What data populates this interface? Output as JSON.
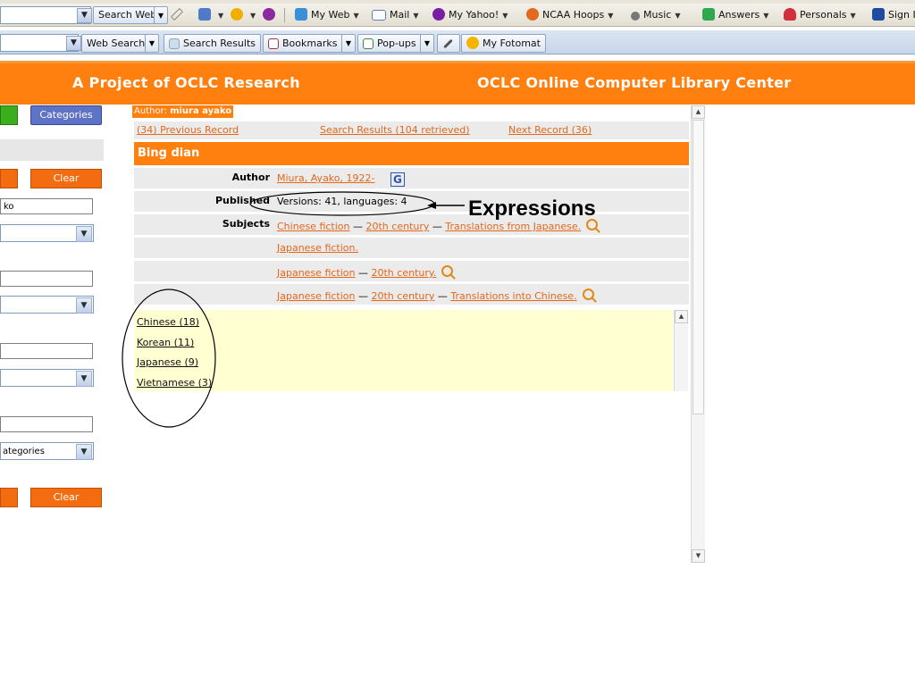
{
  "toolbar1": {
    "search_web": "Search Web",
    "my_web": "My Web",
    "mail": "Mail",
    "my_yahoo": "My Yahoo!",
    "ncaa_hoops": "NCAA Hoops",
    "music": "Music",
    "answers": "Answers",
    "personals": "Personals",
    "sign_in": "Sign In"
  },
  "toolbar2": {
    "web_search": "Web Search",
    "search_results": "Search Results",
    "bookmarks": "Bookmarks",
    "popups": "Pop-ups",
    "my_fotomat": "My Fotomat"
  },
  "banner": {
    "left": "A Project of OCLC Research",
    "right": "OCLC Online Computer Library Center"
  },
  "left_panel": {
    "categories_button": "Categories",
    "clear_button_1": "Clear",
    "clear_button_2": "Clear",
    "author_field_value": "ko",
    "categories_select_value": "ategories"
  },
  "record": {
    "author_prefix": "Author:",
    "author_value": "miura ayako",
    "prev_link": "(34) Previous Record",
    "search_results_link": "Search Results (104 retrieved)",
    "next_link": "Next Record (36)",
    "title": "Bing dian",
    "author_label": "Author",
    "author_link": "Miura, Ayako, 1922-",
    "google_icon_letter": "G",
    "published_label": "Published",
    "published_value": "Versions: 41, languages: 4",
    "subjects_label": "Subjects",
    "subjects": [
      [
        "Chinese fiction",
        "20th century",
        "Translations from Japanese."
      ],
      [
        "Japanese fiction."
      ],
      [
        "Japanese fiction",
        "20th century."
      ],
      [
        "Japanese fiction",
        "20th century",
        "Translations into Chinese."
      ]
    ],
    "subject_separator": " — ",
    "languages": [
      "Chinese (18)",
      "Korean (11)",
      "Japanese (9)",
      "Vietnamese (3)"
    ]
  },
  "annotation": {
    "label": "Expressions"
  },
  "colors": {
    "orange": "#ff7f0f",
    "link": "#e4671a",
    "lang_panel": "#ffffd2"
  }
}
